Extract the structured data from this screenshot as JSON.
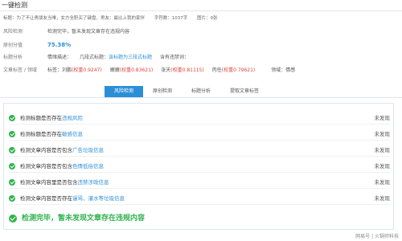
{
  "window": {
    "title": "一键检测"
  },
  "meta": {
    "title_label": "标题：",
    "title_value": "为了不让男朋友当唯，女方全职买了键盘，男友：最比上我的家伴",
    "word_count_label": "字符数：",
    "word_count_value": "1037字",
    "images_label": "图片：",
    "images_value": "0张"
  },
  "risk": {
    "label": "风险检测",
    "value": "检测完毕，暂未发现文章存在违规内容"
  },
  "score": {
    "label": "原创分值",
    "value": "75.38%"
  },
  "title_analysis": {
    "label": "标题分析",
    "emotion_label": "情绪描述：",
    "structure_label": "几段式标题：",
    "structure_value": "该标题为三段式标题",
    "sensitive_label": "含有违禁词："
  },
  "tags": {
    "label": "文章标签 / 领域",
    "prefix": "标签：",
    "items": [
      {
        "name": "刘鹏",
        "score": "(权重0.9247)"
      },
      {
        "name": "嫩嫩",
        "score": "(权重0.83621)"
      },
      {
        "name": "张天",
        "score": "(权重0.81115)"
      },
      {
        "name": "丙任",
        "score": "(权重0.79621)"
      }
    ],
    "domain_label": "领域：",
    "domain_value": "情感"
  },
  "tabs": [
    "风险检测",
    "原创检测",
    "标题分析",
    "提取文章标签"
  ],
  "checks": [
    {
      "text_prefix": "检测标题是否存在",
      "text_link": "违规风险",
      "result": "未发现"
    },
    {
      "text_prefix": "检测标题是否存在",
      "text_link": "敏感信息",
      "result": "未发现"
    },
    {
      "text_prefix": "检测文章内容是否包含",
      "text_link": "广告垃圾信息",
      "result": "未发现"
    },
    {
      "text_prefix": "检测文章内容是否包含",
      "text_link": "色情低俗信息",
      "result": "未发现"
    },
    {
      "text_prefix": "检测文章内容里是否包含",
      "text_link": "违禁涉政信息",
      "result": "未发现"
    },
    {
      "text_prefix": "检测文章内容是否存在",
      "text_link": "谩骂、灌水等垃圾信息",
      "result": "未发现"
    }
  ],
  "final_message": "检测完毕，暂未发现文章存在违规内容",
  "watermark": "网易号 | 火锅师科技",
  "colors": {
    "accent": "#2b8fd8",
    "success": "#2fb34e",
    "warning_red": "#e0433a"
  }
}
